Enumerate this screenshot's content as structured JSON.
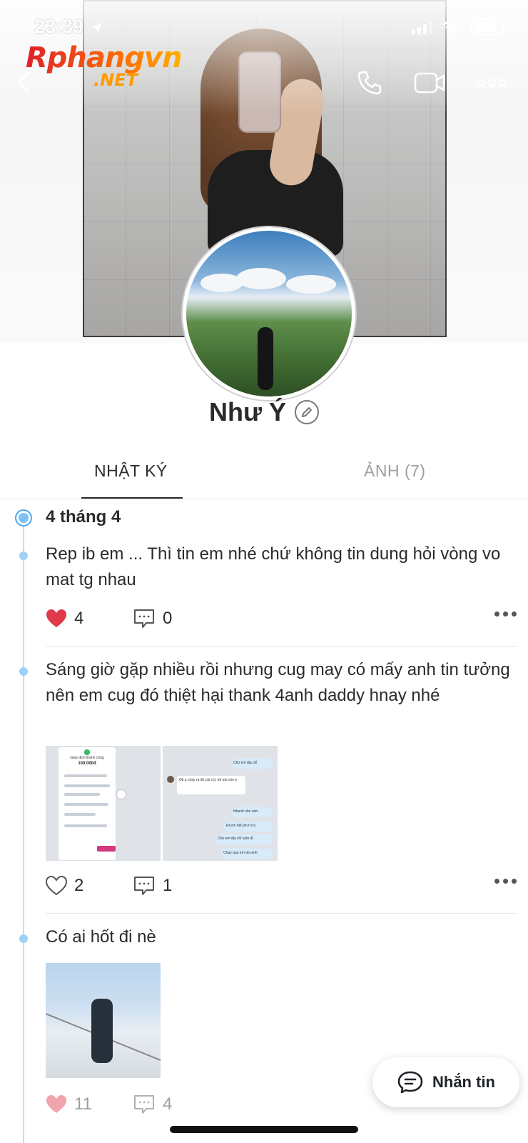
{
  "status_bar": {
    "time": "23:39"
  },
  "watermark": {
    "brand": "Rphangvn",
    "suffix": ".NET"
  },
  "profile": {
    "name": "Như Ý"
  },
  "tabs": [
    {
      "label": "NHẬT KÝ",
      "active": true
    },
    {
      "label": "ẢNH (7)",
      "active": false
    }
  ],
  "feed": {
    "date": "4 tháng 4",
    "posts": [
      {
        "text": "Rep ib em ... Thì tin em nhé chứ không tin dung hỏi vòng vo mat tg nhau",
        "likes": "4",
        "comments": "0",
        "liked": true
      },
      {
        "text": "Sáng giờ gặp nhiều rồi nhưng cug may có mấy anh tin tưởng nên em cug đó thiệt hại thank 4anh daddy hnay nhé",
        "likes": "2",
        "comments": "1",
        "liked": false,
        "images": [
          {
            "title": "Giao dịch thành công",
            "amount": "100.000đ"
          },
          {
            "messages": [
              "Cho em địa chỉ",
              "Ok a chạy ra đó cái có j tới alo cho e",
              "Nhanh nhé anh",
              "Đt em hết pin h roi",
              "Cho em địa chỉ luôn đi",
              "Chạy qua em doi anh"
            ]
          }
        ]
      },
      {
        "text": "Có ai hốt đi nè",
        "likes": "11",
        "comments": "4",
        "liked": true
      }
    ]
  },
  "message_button": {
    "label": "Nhắn tin"
  },
  "colors": {
    "accent": "#4aa8f0",
    "like_red": "#e0394a",
    "timeline": "#bfe0fa"
  }
}
